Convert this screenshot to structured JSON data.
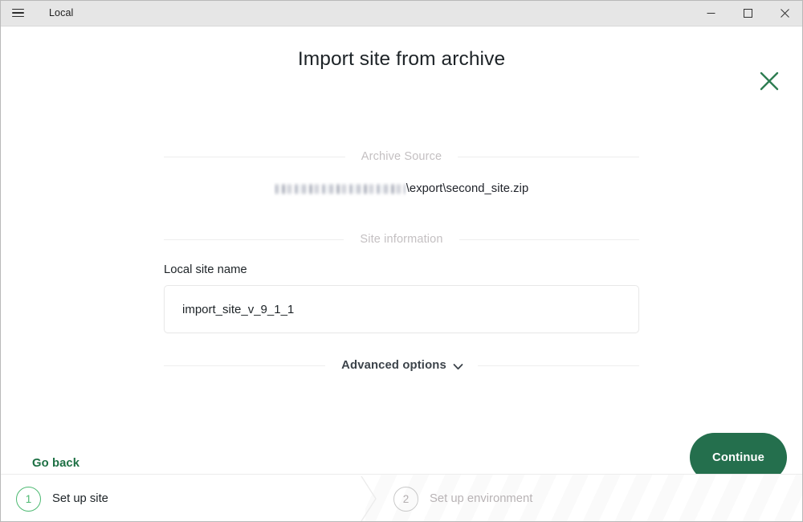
{
  "window": {
    "app_title": "Local",
    "menu_icon": "hamburger-menu-icon",
    "controls": {
      "minimize": "minimize-icon",
      "maximize": "maximize-icon",
      "close": "close-icon"
    }
  },
  "dialog": {
    "title": "Import site from archive",
    "close_icon": "close-x-icon",
    "close_icon_color": "#2e7d52"
  },
  "sections": {
    "archive_source": {
      "divider_label": "Archive Source",
      "path_redacted_prefix": "",
      "path_visible": "\\export\\second_site.zip"
    },
    "site_information": {
      "divider_label": "Site information",
      "field_label": "Local site name",
      "field_value": "import_site_v_9_1_1",
      "field_placeholder": "Local site name"
    },
    "advanced": {
      "divider_label": "Advanced options",
      "chevron_icon": "chevron-down-icon"
    }
  },
  "actions": {
    "go_back": "Go back",
    "continue": "Continue",
    "continue_color": "#246f4d",
    "go_back_color": "#1d7044"
  },
  "stepper": {
    "steps": [
      {
        "number": "1",
        "label": "Set up site",
        "state": "active",
        "color": "#4cb971"
      },
      {
        "number": "2",
        "label": "Set up environment",
        "state": "inactive",
        "color": "#c9c9c9"
      }
    ]
  }
}
